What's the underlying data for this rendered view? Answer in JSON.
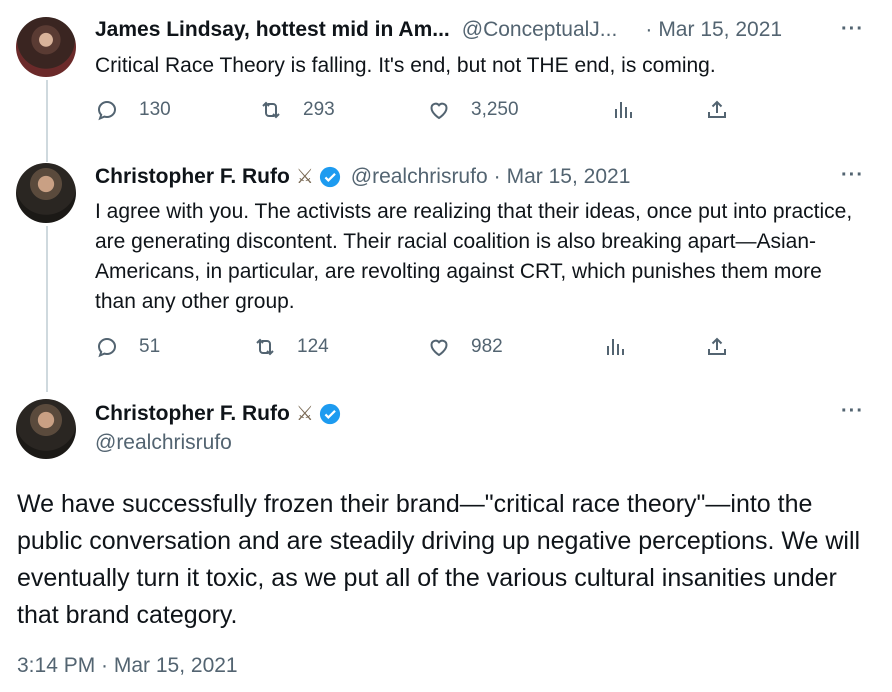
{
  "tweets": [
    {
      "name": "James Lindsay, hottest mid in Am...",
      "handle": "@ConceptualJ...",
      "sep": "·",
      "date": "Mar 15, 2021",
      "text": "Critical Race Theory is falling. It's end, but not THE end, is coming.",
      "replies": "130",
      "retweets": "293",
      "likes": "3,250"
    },
    {
      "name": "Christopher F. Rufo",
      "handle": "@realchrisrufo",
      "sep": "·",
      "date": "Mar 15, 2021",
      "text": "I agree with you. The activists are realizing that their ideas, once put into practice, are generating discontent. Their racial coalition is also breaking apart—Asian-Americans, in particular, are revolting against CRT, which punishes them more than any other group.",
      "replies": "51",
      "retweets": "124",
      "likes": "982"
    }
  ],
  "main": {
    "name": "Christopher F. Rufo",
    "handle": "@realchrisrufo",
    "text": "We have successfully frozen their brand—\"critical race theory\"—into the public conversation and are steadily driving up negative perceptions. We will eventually turn it toxic, as we put all of the various cultural insanities under that brand category.",
    "timestamp": "3:14 PM · Mar 15, 2021"
  },
  "icons": {
    "more": "···",
    "swords": "⚔",
    "verified": "verified-badge-icon",
    "reply": "reply-icon",
    "retweet": "retweet-icon",
    "like": "like-icon",
    "views": "views-icon",
    "share": "share-icon"
  },
  "colors": {
    "verified": "#1d9bf0",
    "secondary_text": "#536471",
    "thread_line": "#cfd9de"
  }
}
